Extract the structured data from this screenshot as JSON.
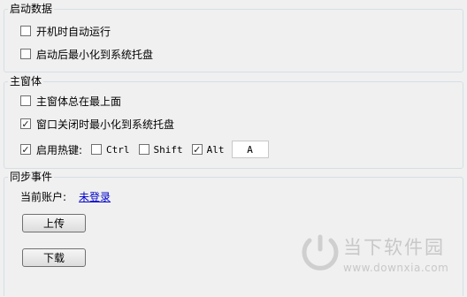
{
  "startup": {
    "title": "启动数据",
    "options": [
      {
        "label": "开机时自动运行",
        "checked": false
      },
      {
        "label": "启动后最小化到系统托盘",
        "checked": false
      }
    ]
  },
  "main_window": {
    "title": "主窗体",
    "options": [
      {
        "label": "主窗体总在最上面",
        "checked": false
      },
      {
        "label": "窗口关闭时最小化到系统托盘",
        "checked": true
      }
    ],
    "hotkey": {
      "enable_label": "启用热键:",
      "enabled": true,
      "ctrl_label": "Ctrl",
      "ctrl_checked": false,
      "shift_label": "Shift",
      "shift_checked": false,
      "alt_label": "Alt",
      "alt_checked": true,
      "key_value": "A"
    }
  },
  "sync": {
    "title": "同步事件",
    "account_label": "当前账户:",
    "account_link": "未登录",
    "upload_label": "上传",
    "download_label": "下载"
  },
  "watermark": {
    "text": "当下软件园",
    "url": "www.downxia.com",
    "color": "#c8c8c8"
  }
}
